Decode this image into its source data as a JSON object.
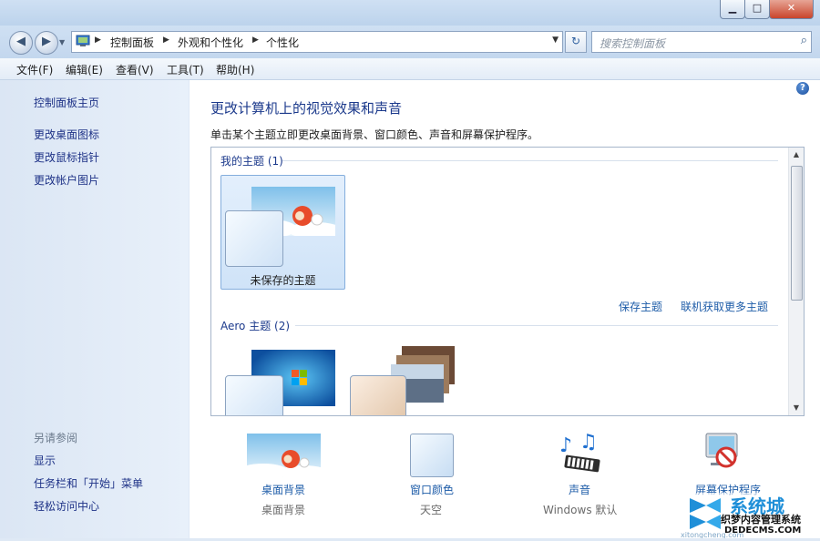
{
  "window": {
    "min_glyph": "▁",
    "max_glyph": "□",
    "close_glyph": "✕"
  },
  "address": {
    "crumbs": [
      "控制面板",
      "外观和个性化",
      "个性化"
    ],
    "back_glyph": "◀",
    "forward_glyph": "▶",
    "refresh_glyph": "↻"
  },
  "search": {
    "placeholder": "搜索控制面板"
  },
  "menu": [
    "文件(F)",
    "编辑(E)",
    "查看(V)",
    "工具(T)",
    "帮助(H)"
  ],
  "sidebar": {
    "home": "控制面板主页",
    "links": [
      "更改桌面图标",
      "更改鼠标指针",
      "更改帐户图片"
    ],
    "see_also_heading": "另请参阅",
    "see_also": [
      "显示",
      "任务栏和「开始」菜单",
      "轻松访问中心"
    ]
  },
  "main": {
    "title": "更改计算机上的视觉效果和声音",
    "description": "单击某个主题立即更改桌面背景、窗口颜色、声音和屏幕保护程序。",
    "my_themes_heading": "我的主题 (1)",
    "unsaved_theme_label": "未保存的主题",
    "save_theme": "保存主题",
    "get_more_themes": "联机获取更多主题",
    "aero_heading": "Aero 主题 (2)"
  },
  "bottom": [
    {
      "label": "桌面背景",
      "sub": "桌面背景",
      "icon": "desktop-background-icon"
    },
    {
      "label": "窗口颜色",
      "sub": "天空",
      "icon": "window-color-icon"
    },
    {
      "label": "声音",
      "sub": "Windows 默认",
      "icon": "sound-icon"
    },
    {
      "label": "屏幕保护程序",
      "sub": "",
      "icon": "screensaver-icon"
    }
  ],
  "watermark": {
    "brand": "系统城",
    "line1": "织梦内容管理系统",
    "line2": "DEDECMS.COM",
    "line3": "xitongcheng.com"
  },
  "colors": {
    "link": "#1e5ca8",
    "title": "#1c3a8c",
    "sidebar_link": "#1e3287"
  }
}
